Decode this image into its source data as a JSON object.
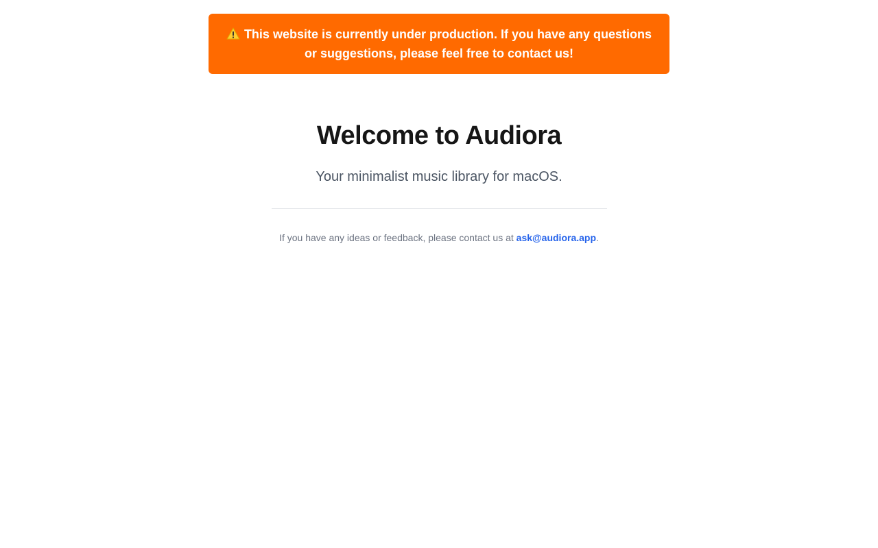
{
  "banner": {
    "icon": "warning-icon",
    "text": "This website is currently under production. If you have any questions or suggestions, please feel free to contact us!",
    "background": "#ff6a00"
  },
  "hero": {
    "title": "Welcome to Audiora",
    "subtitle": "Your minimalist music library for macOS."
  },
  "contact": {
    "prefix": "If you have any ideas or feedback, please contact us at ",
    "email": "ask@audiora.app",
    "suffix": ".",
    "link_color": "#2563eb"
  }
}
